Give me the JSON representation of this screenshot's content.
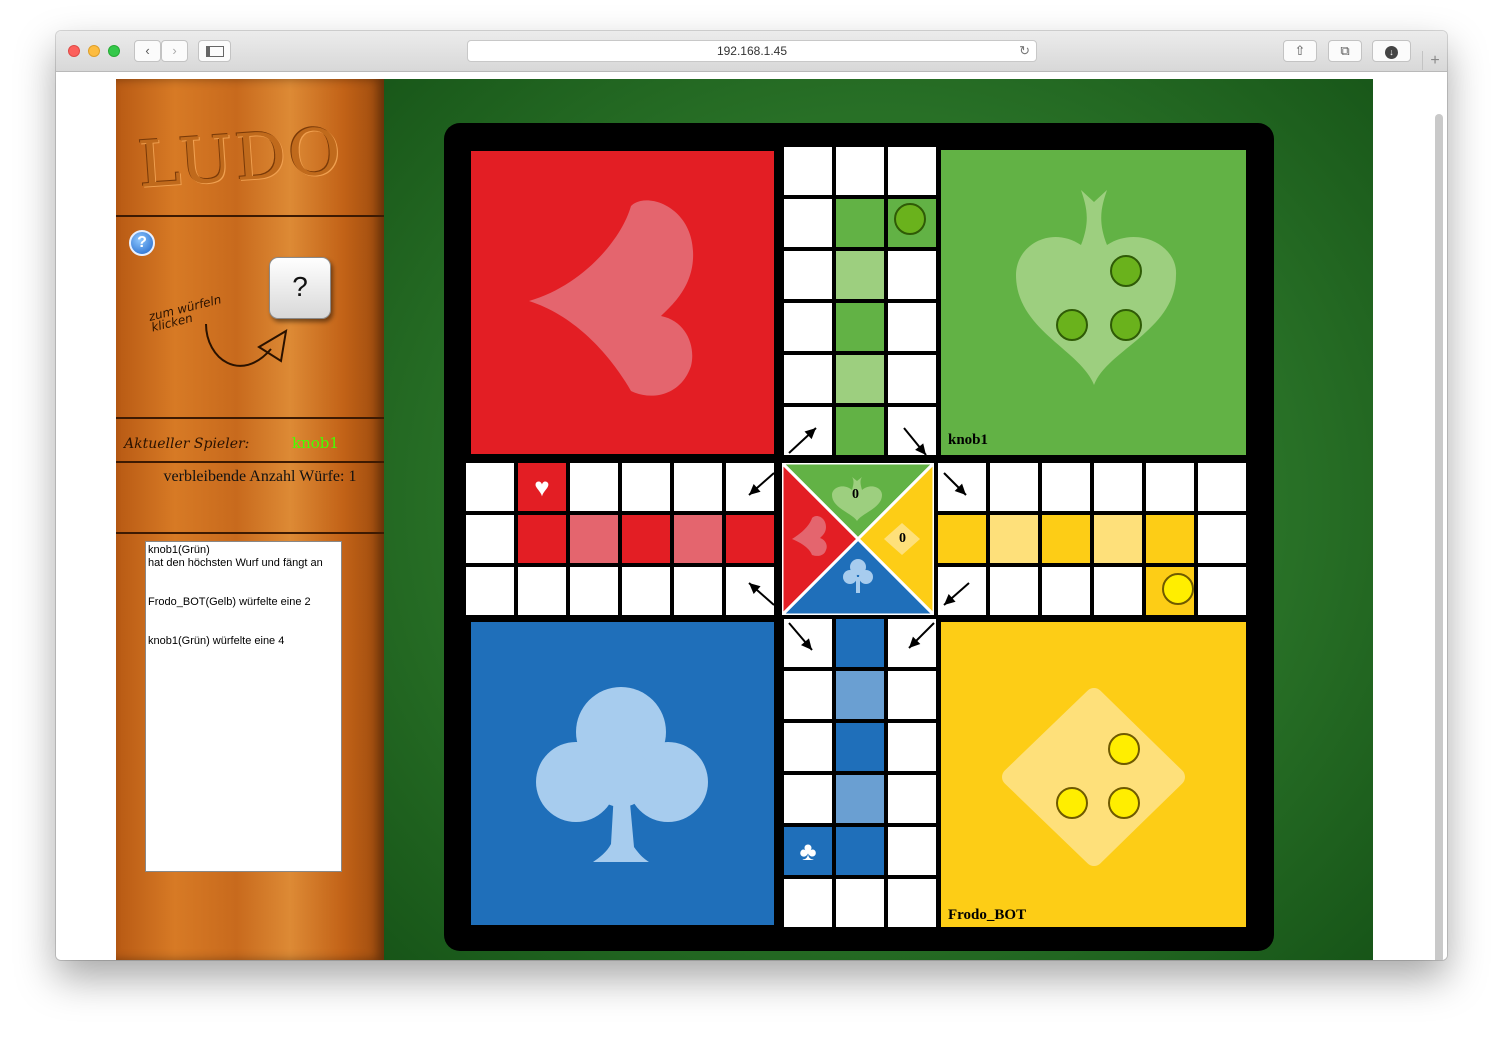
{
  "browser": {
    "url": "192.168.1.45",
    "back_icon": "chevron-left",
    "forward_icon": "chevron-right",
    "sidebar_icon": "sidebar",
    "share_icon": "share",
    "tabs_icon": "tabs",
    "download_icon": "download"
  },
  "sidebar": {
    "title": "LUDO",
    "help_label": "?",
    "dice_label": "?",
    "hint_text": "zum würfeln klicken",
    "current_player_label": "Aktueller Spieler:",
    "current_player": "knob1",
    "remaining_rolls": "verbleibende Anzahl Würfe: 1",
    "log": [
      "knob1(Grün)\nhat den höchsten Wurf und fängt an",
      "Frodo_BOT(Gelb) würfelte eine 2",
      "knob1(Grün) würfelte eine 4"
    ]
  },
  "board": {
    "colors": {
      "red": "#e31e24",
      "red_light": "#e4656e",
      "green": "#62b245",
      "green_light": "#9dcf7f",
      "yellow": "#fdcd16",
      "yellow_light": "#fee07a",
      "blue": "#1f6fba",
      "blue_light": "#6a9fd2"
    },
    "home_labels": {
      "green": "knob1",
      "yellow": "Frodo_BOT"
    },
    "center_counts": {
      "green": "0",
      "yellow": "0"
    },
    "pawns": {
      "green_home": 3,
      "green_on_track": 1,
      "yellow_home": 3,
      "yellow_on_track": 1
    }
  }
}
